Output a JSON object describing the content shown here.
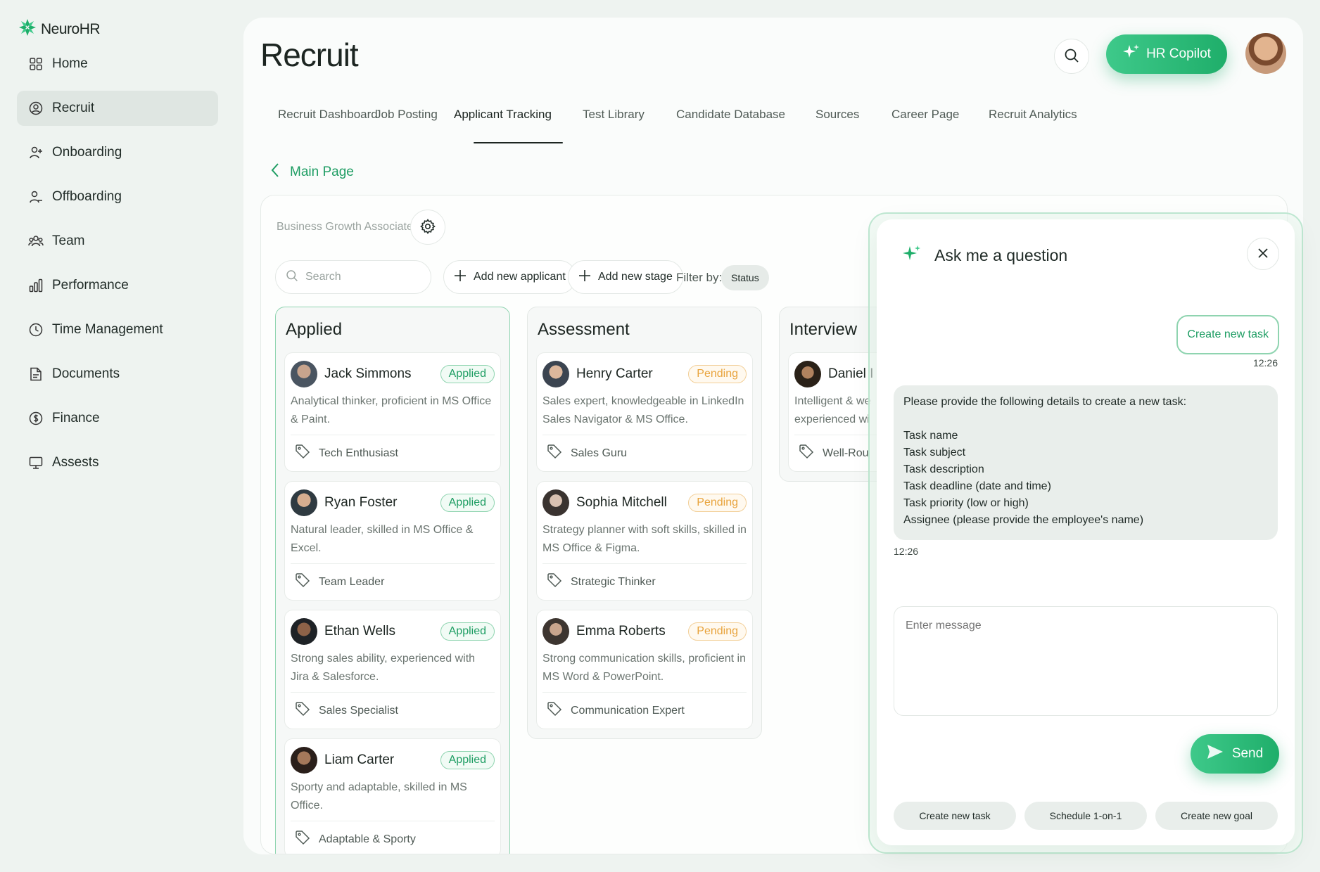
{
  "brand": {
    "name": "NeuroHR"
  },
  "sidebar": {
    "items": [
      {
        "label": "Home",
        "icon": "grid-icon"
      },
      {
        "label": "Recruit",
        "icon": "user-circle-icon",
        "active": true
      },
      {
        "label": "Onboarding",
        "icon": "user-plus-icon"
      },
      {
        "label": "Offboarding",
        "icon": "user-minus-icon"
      },
      {
        "label": "Team",
        "icon": "users-icon"
      },
      {
        "label": "Performance",
        "icon": "bar-chart-icon"
      },
      {
        "label": "Time Management",
        "icon": "clock-icon"
      },
      {
        "label": "Documents",
        "icon": "document-icon"
      },
      {
        "label": "Finance",
        "icon": "dollar-icon"
      },
      {
        "label": "Assests",
        "icon": "monitor-icon"
      }
    ]
  },
  "header": {
    "title": "Recruit",
    "copilot_label": "HR Copilot"
  },
  "tabs": [
    {
      "label": "Recruit Dashboard"
    },
    {
      "label": "Job Posting"
    },
    {
      "label": "Applicant Tracking",
      "active": true
    },
    {
      "label": "Test Library"
    },
    {
      "label": "Candidate Database"
    },
    {
      "label": "Sources"
    },
    {
      "label": "Career Page"
    },
    {
      "label": "Recruit Analytics"
    }
  ],
  "back": {
    "label": "Main Page"
  },
  "board": {
    "job_title": "Business Growth Associate",
    "search_placeholder": "Search",
    "add_applicant_label": "Add new applicant",
    "add_stage_label": "Add new stage",
    "filter_label": "Filter by:",
    "filter_chip": "Status",
    "columns": [
      {
        "title": "Applied",
        "cards": [
          {
            "name": "Jack Simmons",
            "status": "Applied",
            "desc": "Analytical thinker, proficient in MS Office & Paint.",
            "tag": "Tech Enthusiast"
          },
          {
            "name": "Ryan Foster",
            "status": "Applied",
            "desc": "Natural leader, skilled in MS Office & Excel.",
            "tag": "Team Leader"
          },
          {
            "name": "Ethan Wells",
            "status": "Applied",
            "desc": " Strong sales ability, experienced with Jira & Salesforce.",
            "tag": "Sales Specialist"
          },
          {
            "name": "Liam Carter",
            "status": "Applied",
            "desc": "Sporty and adaptable, skilled in MS Office.",
            "tag": "Adaptable & Sporty"
          }
        ]
      },
      {
        "title": "Assessment",
        "cards": [
          {
            "name": "Henry Carter",
            "status": "Pending",
            "desc": "Sales expert, knowledgeable in LinkedIn Sales Navigator & MS Office.",
            "tag": "Sales Guru"
          },
          {
            "name": "Sophia Mitchell",
            "status": "Pending",
            "desc": "Strategy planner with soft skills, skilled in MS Office & Figma.",
            "tag": "Strategic Thinker"
          },
          {
            "name": "Emma Roberts",
            "status": "Pending",
            "desc": "Strong communication skills, proficient in MS Word & PowerPoint.",
            "tag": "Communication Expert"
          }
        ]
      },
      {
        "title": "Interview",
        "cards": [
          {
            "name": "Daniel I",
            "status": "",
            "desc": "Intelligent & we experienced wi Office.",
            "tag": "Well-Rou"
          }
        ]
      }
    ]
  },
  "chat": {
    "title": "Ask me a question",
    "user_message": "Create new task",
    "user_time": "12:26",
    "bot_lines": [
      "Please provide the following details to create a new task:",
      "",
      "Task name",
      "Task subject",
      "Task description",
      "Task deadline (date and time)",
      "Task priority (low or high)",
      "Assignee (please provide the employee's name)"
    ],
    "bot_time": "12:26",
    "input_placeholder": "Enter message",
    "send_label": "Send",
    "quick_actions": [
      "Create new task",
      "Schedule 1-on-1",
      "Create new goal"
    ]
  },
  "colors": {
    "accent": "#1e9d63",
    "pending": "#e8a33c",
    "background": "#eef3f0"
  }
}
